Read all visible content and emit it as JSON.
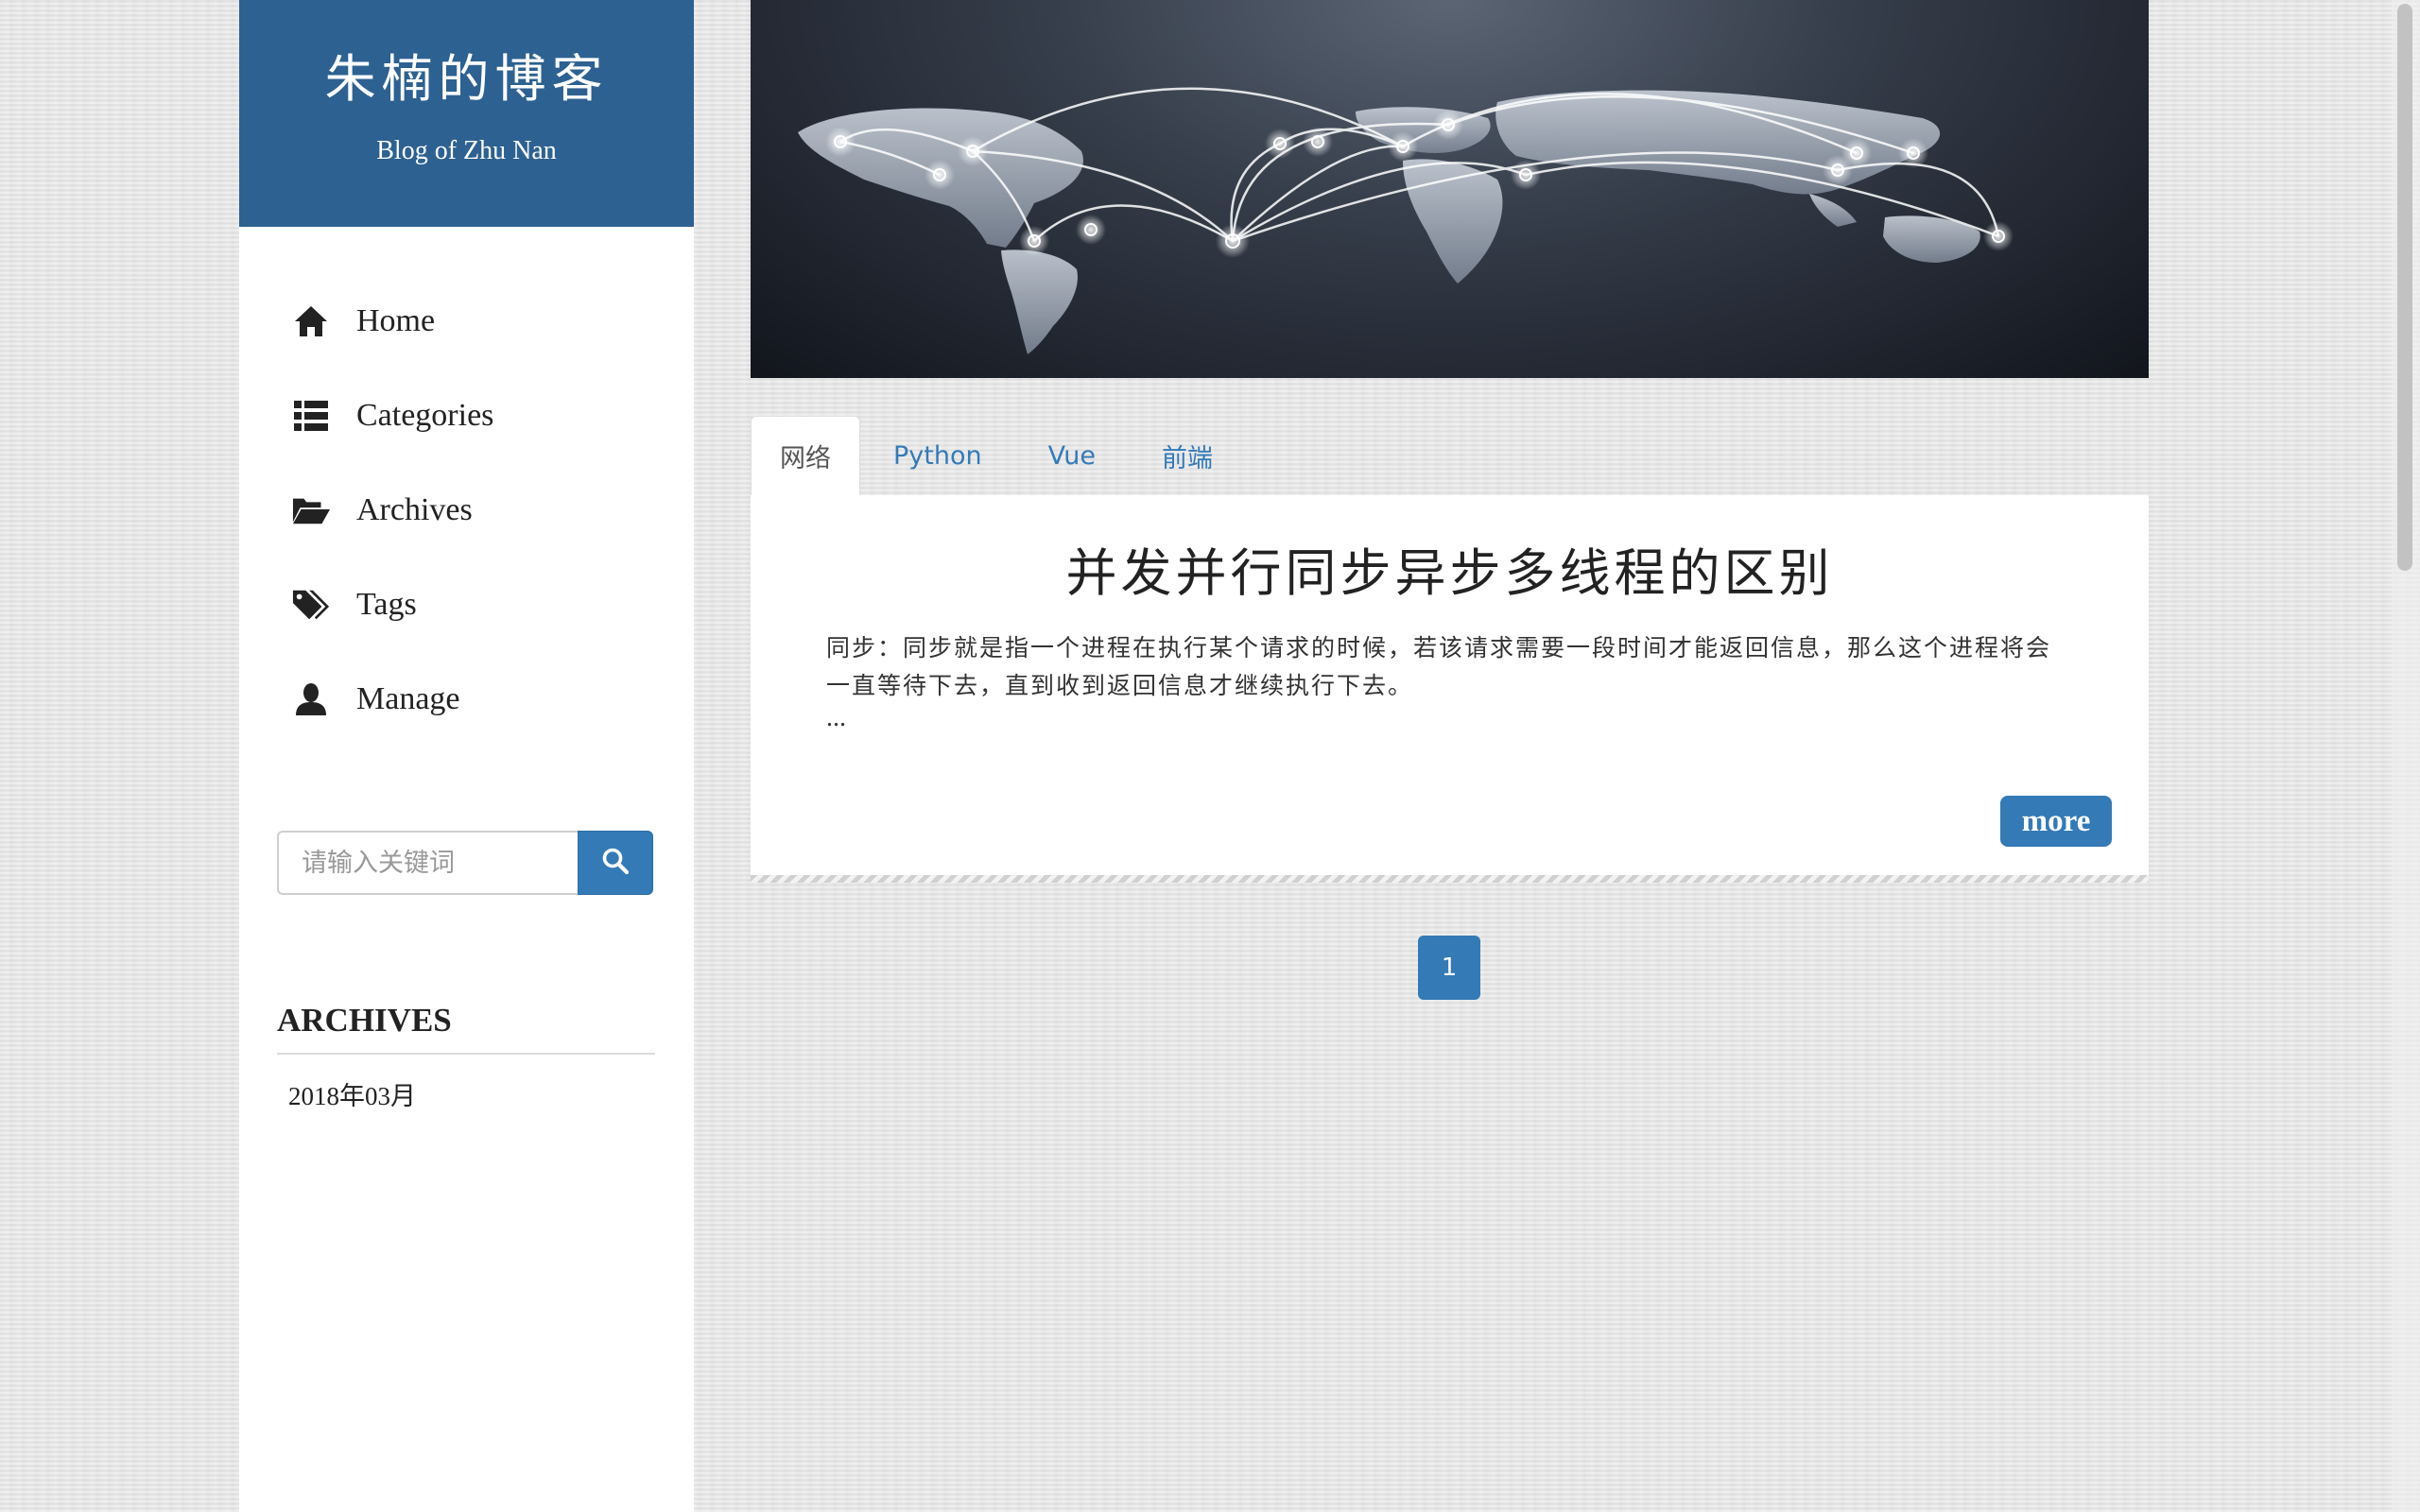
{
  "brand": {
    "title": "朱楠的博客",
    "subtitle": "Blog of Zhu Nan",
    "color": "#2d6191"
  },
  "nav": {
    "items": [
      {
        "label": "Home",
        "icon": "home-icon"
      },
      {
        "label": "Categories",
        "icon": "list-icon"
      },
      {
        "label": "Archives",
        "icon": "folder-open-icon"
      },
      {
        "label": "Tags",
        "icon": "tags-icon"
      },
      {
        "label": "Manage",
        "icon": "user-icon"
      }
    ]
  },
  "search": {
    "placeholder": "请输入关键词",
    "icon": "search-icon"
  },
  "archives": {
    "title": "ARCHIVES",
    "items": [
      "2018年03月"
    ]
  },
  "tabs": [
    {
      "label": "网络",
      "active": true
    },
    {
      "label": "Python",
      "active": false
    },
    {
      "label": "Vue",
      "active": false
    },
    {
      "label": "前端",
      "active": false
    }
  ],
  "post": {
    "title": "并发并行同步异步多线程的区别",
    "excerpt": "同步：同步就是指一个进程在执行某个请求的时候，若该请求需要一段时间才能返回信息，那么这个进程将会一直等待下去，直到收到返回信息才继续执行下去。",
    "ellipsis": "...",
    "more_label": "more"
  },
  "pagination": {
    "current": "1"
  },
  "accent_color": "#337ab7"
}
